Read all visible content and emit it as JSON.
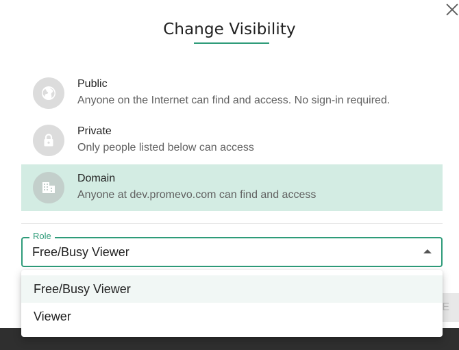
{
  "dialog": {
    "title": "Change Visibility",
    "accent_color": "#2e9b79",
    "close_icon": "close-icon"
  },
  "options": [
    {
      "title": "Public",
      "description": "Anyone on the Internet can find and access. No sign-in required.",
      "icon": "globe-icon",
      "selected": false
    },
    {
      "title": "Private",
      "description": "Only people listed below can access",
      "icon": "lock-icon",
      "selected": false
    },
    {
      "title": "Domain",
      "description": "Anyone at dev.promevo.com can find and access",
      "icon": "building-icon",
      "selected": true
    }
  ],
  "role": {
    "label": "Role",
    "value": "Free/Busy Viewer",
    "options": [
      "Free/Busy Viewer",
      "Viewer"
    ]
  },
  "partially_hidden_button": {
    "label_fragment": "E"
  },
  "colors": {
    "selected_row_bg": "#d3ece3",
    "icon_circle_bg": "#dcdcdc",
    "bottom_bar": "#2f2f2f"
  }
}
